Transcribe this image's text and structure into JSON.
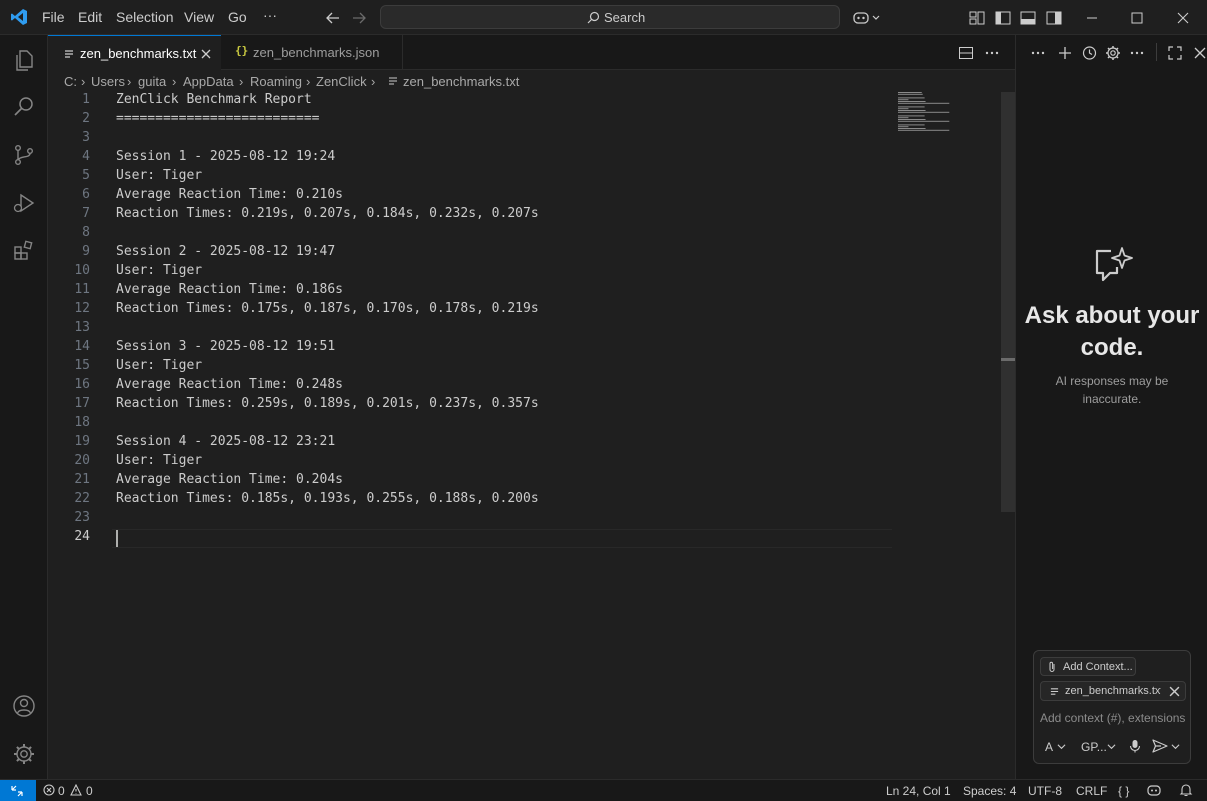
{
  "menu": [
    "File",
    "Edit",
    "Selection",
    "View",
    "Go",
    "···"
  ],
  "search": {
    "label": "Search"
  },
  "tabs": [
    {
      "label": "zen_benchmarks.txt",
      "icon": "text-file-icon",
      "active": true
    },
    {
      "label": "zen_benchmarks.json",
      "icon": "json-braces-icon",
      "active": false
    }
  ],
  "breadcrumb": [
    "C:",
    "Users",
    "guita",
    "AppData",
    "Roaming",
    "ZenClick",
    "zen_benchmarks.txt"
  ],
  "editor": {
    "lines": [
      "ZenClick Benchmark Report",
      "==========================",
      "",
      "Session 1 - 2025-08-12 19:24",
      "User: Tiger",
      "Average Reaction Time: 0.210s",
      "Reaction Times: 0.219s, 0.207s, 0.184s, 0.232s, 0.207s",
      "",
      "Session 2 - 2025-08-12 19:47",
      "User: Tiger",
      "Average Reaction Time: 0.186s",
      "Reaction Times: 0.175s, 0.187s, 0.170s, 0.178s, 0.219s",
      "",
      "Session 3 - 2025-08-12 19:51",
      "User: Tiger",
      "Average Reaction Time: 0.248s",
      "Reaction Times: 0.259s, 0.189s, 0.201s, 0.237s, 0.357s",
      "",
      "Session 4 - 2025-08-12 23:21",
      "User: Tiger",
      "Average Reaction Time: 0.204s",
      "Reaction Times: 0.185s, 0.193s, 0.255s, 0.188s, 0.200s",
      "",
      ""
    ],
    "current_line": 24
  },
  "chat": {
    "title": "Ask about your code.",
    "subtitle": "AI responses may be inaccurate.",
    "add_context": "Add Context...",
    "file_chip": "zen_benchmarks.txt",
    "placeholder": "Add context (#), extensions",
    "mode": "A",
    "model": "GP..."
  },
  "status": {
    "errors": "0",
    "warnings": "0",
    "position": "Ln 24, Col 1",
    "spaces": "Spaces: 4",
    "encoding": "UTF-8",
    "eol": "CRLF",
    "language": "{ }"
  },
  "colors": {
    "accent": "#0078d4",
    "background": "#1f1f1f",
    "sidebar": "#181818"
  }
}
